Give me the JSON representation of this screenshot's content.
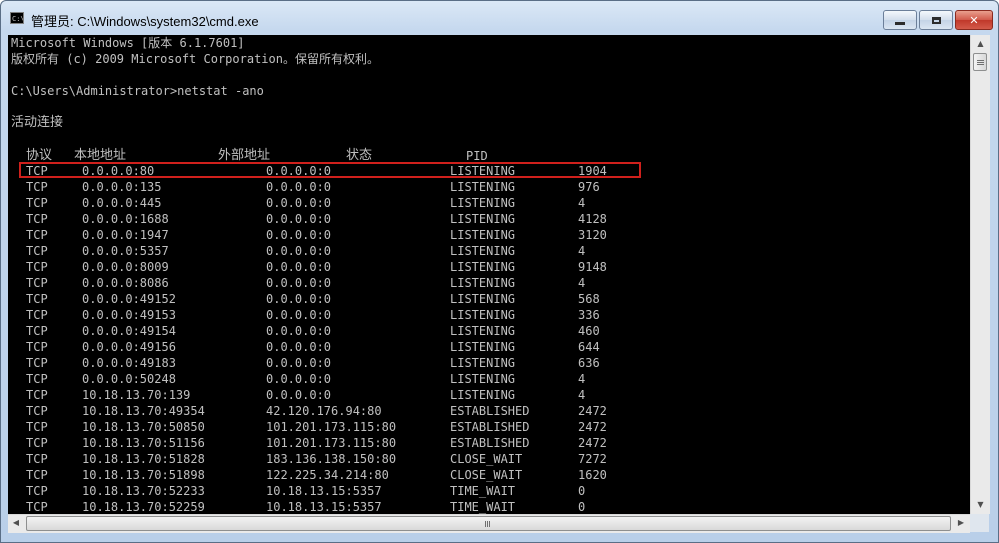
{
  "window": {
    "title": "管理员: C:\\Windows\\system32\\cmd.exe",
    "icon_text": "C:\\"
  },
  "console": {
    "lines": [
      "Microsoft Windows [版本 6.1.7601]",
      "版权所有 (c) 2009 Microsoft Corporation。保留所有权利。",
      "",
      "C:\\Users\\Administrator>netstat -ano",
      "活动连接"
    ],
    "headers": {
      "proto": "协议",
      "local": "本地地址",
      "foreign": "外部地址",
      "state": "状态",
      "pid": "PID"
    },
    "rows": [
      {
        "proto": "TCP",
        "local": "0.0.0.0:80",
        "foreign": "0.0.0.0:0",
        "state": "LISTENING",
        "pid": "1904"
      },
      {
        "proto": "TCP",
        "local": "0.0.0.0:135",
        "foreign": "0.0.0.0:0",
        "state": "LISTENING",
        "pid": "976"
      },
      {
        "proto": "TCP",
        "local": "0.0.0.0:445",
        "foreign": "0.0.0.0:0",
        "state": "LISTENING",
        "pid": "4"
      },
      {
        "proto": "TCP",
        "local": "0.0.0.0:1688",
        "foreign": "0.0.0.0:0",
        "state": "LISTENING",
        "pid": "4128"
      },
      {
        "proto": "TCP",
        "local": "0.0.0.0:1947",
        "foreign": "0.0.0.0:0",
        "state": "LISTENING",
        "pid": "3120"
      },
      {
        "proto": "TCP",
        "local": "0.0.0.0:5357",
        "foreign": "0.0.0.0:0",
        "state": "LISTENING",
        "pid": "4"
      },
      {
        "proto": "TCP",
        "local": "0.0.0.0:8009",
        "foreign": "0.0.0.0:0",
        "state": "LISTENING",
        "pid": "9148"
      },
      {
        "proto": "TCP",
        "local": "0.0.0.0:8086",
        "foreign": "0.0.0.0:0",
        "state": "LISTENING",
        "pid": "4"
      },
      {
        "proto": "TCP",
        "local": "0.0.0.0:49152",
        "foreign": "0.0.0.0:0",
        "state": "LISTENING",
        "pid": "568"
      },
      {
        "proto": "TCP",
        "local": "0.0.0.0:49153",
        "foreign": "0.0.0.0:0",
        "state": "LISTENING",
        "pid": "336"
      },
      {
        "proto": "TCP",
        "local": "0.0.0.0:49154",
        "foreign": "0.0.0.0:0",
        "state": "LISTENING",
        "pid": "460"
      },
      {
        "proto": "TCP",
        "local": "0.0.0.0:49156",
        "foreign": "0.0.0.0:0",
        "state": "LISTENING",
        "pid": "644"
      },
      {
        "proto": "TCP",
        "local": "0.0.0.0:49183",
        "foreign": "0.0.0.0:0",
        "state": "LISTENING",
        "pid": "636"
      },
      {
        "proto": "TCP",
        "local": "0.0.0.0:50248",
        "foreign": "0.0.0.0:0",
        "state": "LISTENING",
        "pid": "4"
      },
      {
        "proto": "TCP",
        "local": "10.18.13.70:139",
        "foreign": "0.0.0.0:0",
        "state": "LISTENING",
        "pid": "4"
      },
      {
        "proto": "TCP",
        "local": "10.18.13.70:49354",
        "foreign": "42.120.176.94:80",
        "state": "ESTABLISHED",
        "pid": "2472"
      },
      {
        "proto": "TCP",
        "local": "10.18.13.70:50850",
        "foreign": "101.201.173.115:80",
        "state": "ESTABLISHED",
        "pid": "2472"
      },
      {
        "proto": "TCP",
        "local": "10.18.13.70:51156",
        "foreign": "101.201.173.115:80",
        "state": "ESTABLISHED",
        "pid": "2472"
      },
      {
        "proto": "TCP",
        "local": "10.18.13.70:51828",
        "foreign": "183.136.138.150:80",
        "state": "CLOSE_WAIT",
        "pid": "7272"
      },
      {
        "proto": "TCP",
        "local": "10.18.13.70:51898",
        "foreign": "122.225.34.214:80",
        "state": "CLOSE_WAIT",
        "pid": "1620"
      },
      {
        "proto": "TCP",
        "local": "10.18.13.70:52233",
        "foreign": "10.18.13.15:5357",
        "state": "TIME_WAIT",
        "pid": "0"
      },
      {
        "proto": "TCP",
        "local": "10.18.13.70:52259",
        "foreign": "10.18.13.15:5357",
        "state": "TIME_WAIT",
        "pid": "0"
      }
    ],
    "highlighted_row": 0
  },
  "colors": {
    "console_bg": "#000000",
    "console_fg": "#c0c0c0",
    "highlight_border": "#d0201c"
  },
  "icons": {
    "app": "cmd-icon",
    "minimize": "minimize-icon",
    "maximize": "maximize-icon",
    "close": "close-icon",
    "scroll_up": "arrow-up-icon",
    "scroll_down": "arrow-down-icon",
    "scroll_left": "arrow-left-icon",
    "scroll_right": "arrow-right-icon"
  }
}
